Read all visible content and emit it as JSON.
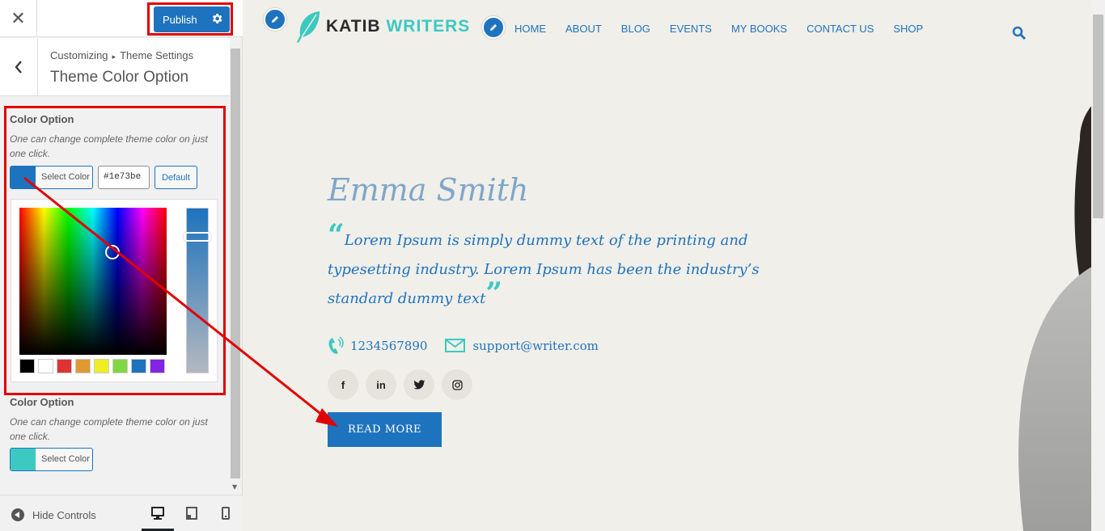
{
  "customizer": {
    "close_glyph": "✕",
    "publish_label": "Publish",
    "breadcrumb": {
      "root": "Customizing",
      "separator": "▸",
      "section": "Theme Settings"
    },
    "section_title": "Theme Color Option",
    "controls": [
      {
        "title": "Color Option",
        "description": "One can change complete theme color on just one click.",
        "select_label": "Select Color",
        "color": "#1e73be",
        "hex_value": "#1e73be",
        "default_label": "Default"
      },
      {
        "title": "Color Option",
        "description": "One can change complete theme color on just one click.",
        "select_label": "Select Color",
        "color": "#3cc9c2"
      }
    ],
    "palette": [
      "#000000",
      "#ffffff",
      "#dd3333",
      "#dd9933",
      "#eeee22",
      "#81d742",
      "#1e73be",
      "#8224e3"
    ],
    "footer": {
      "hide_controls": "Hide Controls",
      "devices": [
        "desktop-icon",
        "tablet-icon",
        "mobile-icon"
      ]
    }
  },
  "site": {
    "logo": {
      "word1": "KATIB",
      "word2": "WRITERS"
    },
    "nav": [
      "HOME",
      "ABOUT",
      "BLOG",
      "EVENTS",
      "MY BOOKS",
      "CONTACT US",
      "SHOP"
    ],
    "hero": {
      "name": "Emma Smith",
      "quote": "Lorem Ipsum is simply dummy text of the printing and typesetting industry. Lorem Ipsum has been the industry’s standard dummy text",
      "phone": "1234567890",
      "email": "support@writer.com",
      "socials": [
        "f",
        "in",
        "twitter-icon",
        "instagram-icon"
      ],
      "cta": "READ MORE"
    },
    "colors": {
      "primary": "#1e73be",
      "accent": "#3cc9c2",
      "background": "#f1efe9"
    }
  }
}
